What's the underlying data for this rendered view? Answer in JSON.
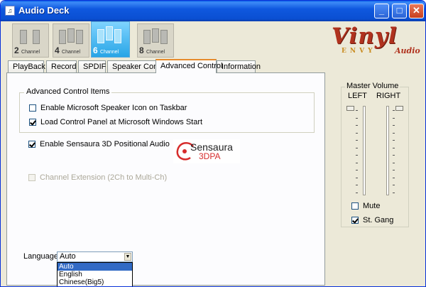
{
  "window": {
    "title": "Audio Deck",
    "controls": [
      "minimize",
      "maximize",
      "close"
    ]
  },
  "channels": [
    {
      "num": "2",
      "label": "Channel",
      "active": false
    },
    {
      "num": "4",
      "label": "Channel",
      "active": false
    },
    {
      "num": "6",
      "label": "Channel",
      "active": true
    },
    {
      "num": "8",
      "label": "Channel",
      "active": false
    }
  ],
  "logo": {
    "main": "Vinyl",
    "sub": "ENVY",
    "audio": "Audio"
  },
  "tabs": [
    "PlayBack",
    "Record",
    "SPDIF",
    "Speaker Config",
    "Advanced Control",
    "Information"
  ],
  "active_tab": "Advanced Control",
  "advanced": {
    "group_title": "Advanced Control Items",
    "items": [
      {
        "label": "Enable Microsoft Speaker Icon on Taskbar",
        "checked": false,
        "enabled": true
      },
      {
        "label": "Load Control Panel at Microsoft Windows Start",
        "checked": true,
        "enabled": true
      }
    ],
    "sensaura": {
      "label": "Enable Sensaura 3D Positional Audio",
      "checked": true
    },
    "sensaura_logo": {
      "name": "Sensaura",
      "sub": "3DPA"
    },
    "channel_ext": {
      "label": "Channel Extension (2Ch to Multi-Ch)",
      "checked": false,
      "enabled": false
    }
  },
  "language": {
    "label": "Language:",
    "value": "Auto",
    "options": [
      "Auto",
      "English",
      "Chinese(Big5)"
    ],
    "highlighted": "Auto"
  },
  "master_volume": {
    "title": "Master Volume",
    "left_label": "LEFT",
    "right_label": "RIGHT",
    "left_level": 1.0,
    "right_level": 1.0,
    "mute_label": "Mute",
    "mute_checked": false,
    "gang_label": "St. Gang",
    "gang_checked": true
  },
  "colors": {
    "titlebar": "#0a4fd2",
    "active_tab_accent": "#e68b2c",
    "logo_red": "#b0321e",
    "active_channel": "#27a5e6"
  }
}
